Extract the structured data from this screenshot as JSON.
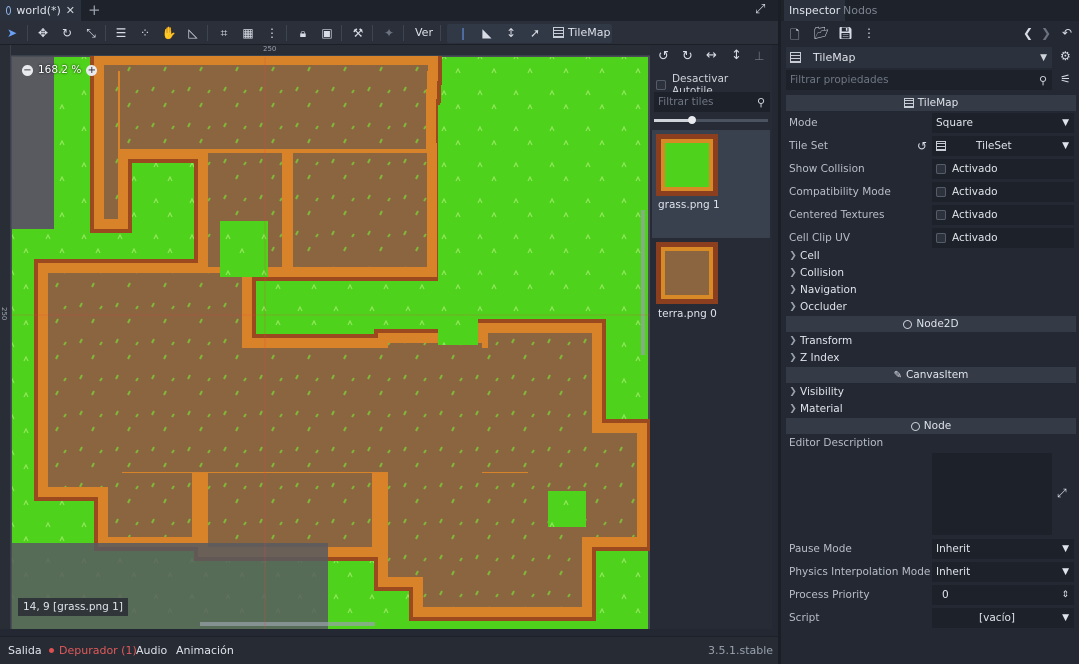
{
  "scene_tab": {
    "label": "world(*)"
  },
  "toolbar": {
    "view_label": "Ver",
    "tilemap_label": "TileMap"
  },
  "viewport": {
    "zoom": "168.2 %",
    "status": "14, 9 [grass.png 1]",
    "ruler_top_mark": "250",
    "ruler_left_mark": "250"
  },
  "tile_panel": {
    "disable_autotile_label": "Desactivar Autotile",
    "filter_placeholder": "Filtrar tiles",
    "tiles": [
      {
        "label": "grass.png 1"
      },
      {
        "label": "terra.png 0"
      }
    ]
  },
  "bottom_panel": {
    "tabs": [
      "Salida",
      "Depurador (1)",
      "Audio",
      "Animación"
    ],
    "version": "3.5.1.stable"
  },
  "inspector": {
    "tabs": [
      "Inspector",
      "Nodos"
    ],
    "object_name": "TileMap",
    "filter_placeholder": "Filtrar propiedades",
    "section_tilemap": "TileMap",
    "props_tilemap": [
      {
        "label": "Mode",
        "value": "Square"
      },
      {
        "label": "Tile Set",
        "value": "TileSet"
      },
      {
        "label": "Show Collision",
        "value": "Activado"
      },
      {
        "label": "Compatibility Mode",
        "value": "Activado"
      },
      {
        "label": "Centered Textures",
        "value": "Activado"
      },
      {
        "label": "Cell Clip UV",
        "value": "Activado"
      }
    ],
    "cats_tilemap": [
      "Cell",
      "Collision",
      "Navigation",
      "Occluder"
    ],
    "section_node2d": "Node2D",
    "cats_node2d": [
      "Transform",
      "Z Index"
    ],
    "section_canvasitem": "CanvasItem",
    "cats_canvasitem": [
      "Visibility",
      "Material"
    ],
    "section_node": "Node",
    "editor_description_label": "Editor Description",
    "props_node": [
      {
        "label": "Pause Mode",
        "value": "Inherit"
      },
      {
        "label": "Physics Interpolation Mode",
        "value": "Inherit"
      },
      {
        "label": "Process Priority",
        "value": "0"
      },
      {
        "label": "Script",
        "value": "[vacío]"
      }
    ]
  },
  "colors": {
    "accent": "#6aa0f5",
    "grass": "#4fd21b",
    "dirt": "#8b6440",
    "error_dot": "#e05050"
  }
}
